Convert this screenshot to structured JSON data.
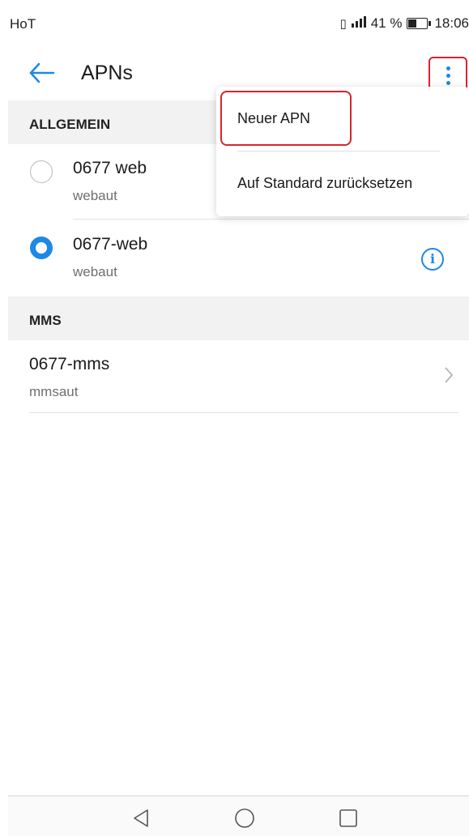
{
  "status_bar": {
    "carrier": "HoT",
    "network_icons": "📳 LTE",
    "battery_percent": "41 %",
    "time": "18:06"
  },
  "app_bar": {
    "title": "APNs",
    "back_icon": "arrow-left-icon",
    "more_icon": "more-vertical-icon"
  },
  "sections": [
    {
      "header": "ALLGEMEIN",
      "items": [
        {
          "title": "0677 web",
          "subtitle": "webaut",
          "selected": false
        },
        {
          "title": "0677-web",
          "subtitle": "webaut",
          "selected": true,
          "info_icon": "info-icon"
        }
      ]
    },
    {
      "header": "MMS",
      "items": [
        {
          "title": "0677-mms",
          "subtitle": "mmsaut",
          "chevron_icon": "chevron-right-icon"
        }
      ]
    }
  ],
  "menu": {
    "items": [
      "Neuer APN",
      "Auf Standard zurücksetzen"
    ]
  },
  "nav_bar": {
    "icons": [
      "back-triangle-icon",
      "home-circle-icon",
      "recents-square-icon"
    ]
  },
  "colors": {
    "accent": "#1e88e5",
    "highlight": "#d9232e",
    "section_bg": "#f2f2f2"
  }
}
